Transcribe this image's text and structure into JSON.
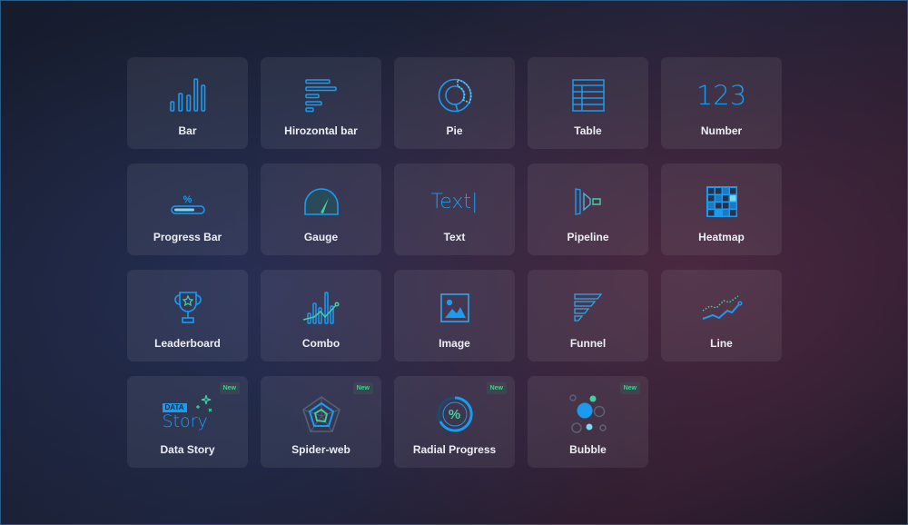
{
  "colors": {
    "accent": "#1a9bef",
    "green": "#45d0a0",
    "badge_text": "#3fcf8e"
  },
  "widgets": [
    {
      "label": "Bar",
      "icon": "bar-chart-icon"
    },
    {
      "label": "Hirozontal bar",
      "icon": "horizontal-bar-icon"
    },
    {
      "label": "Pie",
      "icon": "pie-chart-icon"
    },
    {
      "label": "Table",
      "icon": "table-icon"
    },
    {
      "label": "Number",
      "icon": "number-icon",
      "icon_text": "123"
    },
    {
      "label": "Progress Bar",
      "icon": "progress-bar-icon",
      "icon_text": "%"
    },
    {
      "label": "Gauge",
      "icon": "gauge-icon"
    },
    {
      "label": "Text",
      "icon": "text-icon",
      "icon_text": "Text|"
    },
    {
      "label": "Pipeline",
      "icon": "pipeline-icon"
    },
    {
      "label": "Heatmap",
      "icon": "heatmap-icon"
    },
    {
      "label": "Leaderboard",
      "icon": "trophy-icon"
    },
    {
      "label": "Combo",
      "icon": "combo-chart-icon"
    },
    {
      "label": "Image",
      "icon": "image-icon"
    },
    {
      "label": "Funnel",
      "icon": "funnel-icon"
    },
    {
      "label": "Line",
      "icon": "line-chart-icon"
    },
    {
      "label": "Data Story",
      "icon": "data-story-icon",
      "icon_text": "DATA",
      "icon_text2": "Story",
      "badge": "New"
    },
    {
      "label": "Spider-web",
      "icon": "spider-web-icon",
      "badge": "New"
    },
    {
      "label": "Radial Progress",
      "icon": "radial-progress-icon",
      "icon_text": "%",
      "badge": "New"
    },
    {
      "label": "Bubble",
      "icon": "bubble-icon",
      "badge": "New"
    }
  ]
}
